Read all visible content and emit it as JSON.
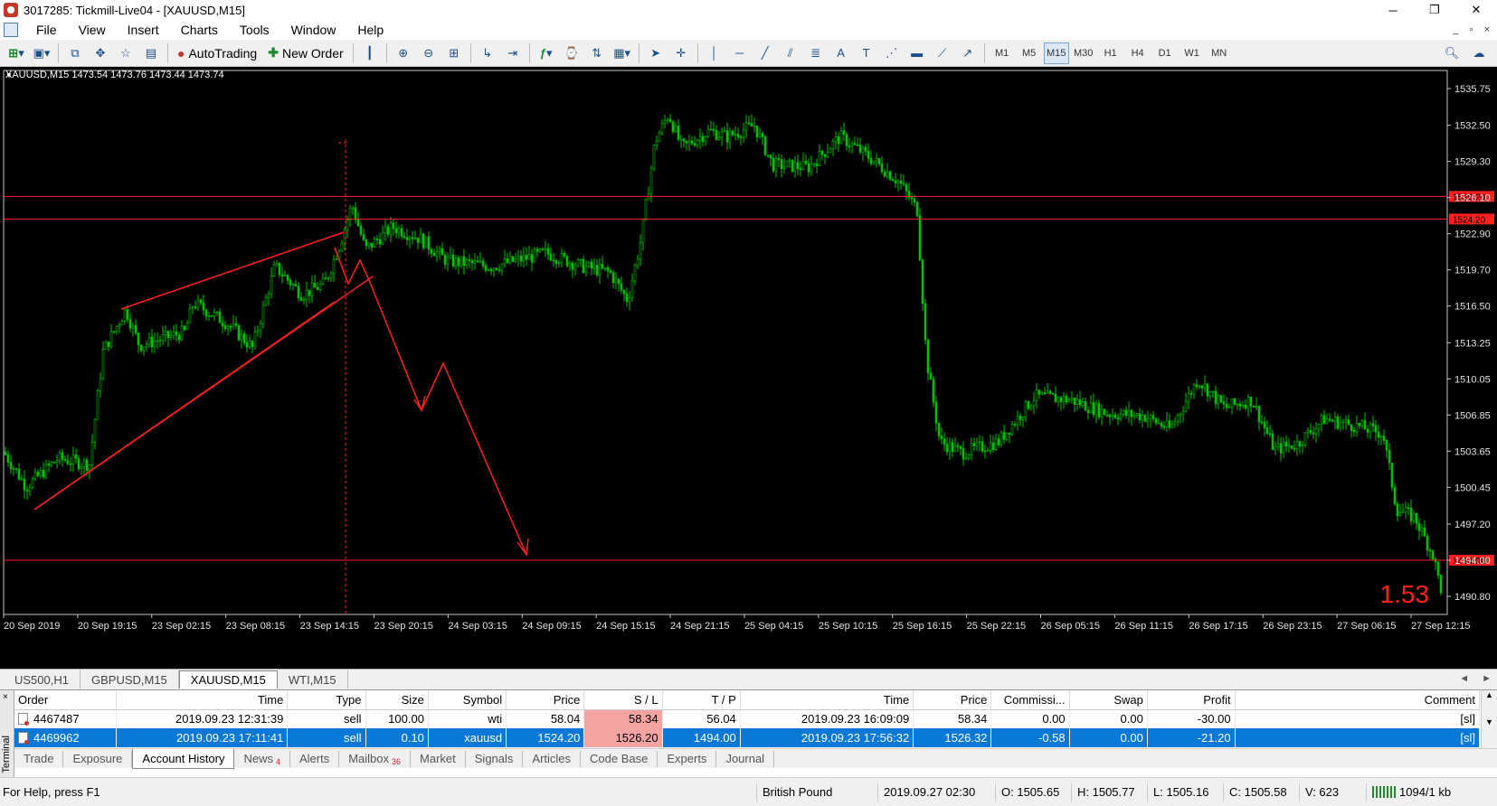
{
  "window": {
    "title": "3017285: Tickmill-Live04 - [XAUUSD,M15]",
    "controls": [
      "─",
      "❐",
      "✕"
    ]
  },
  "menu": {
    "items": [
      "File",
      "View",
      "Insert",
      "Charts",
      "Tools",
      "Window",
      "Help"
    ],
    "mdi_controls": [
      "_",
      "▫",
      "×"
    ]
  },
  "toolbar": {
    "autotrading_label": "AutoTrading",
    "new_order_label": "New Order",
    "timeframes": [
      "M1",
      "M5",
      "M15",
      "M30",
      "H1",
      "H4",
      "D1",
      "W1",
      "MN"
    ],
    "active_timeframe": "M15"
  },
  "chart": {
    "info": "XAUUSD,M15  1473.54 1473.76 1473.44 1473.74",
    "spread_label": "1.53",
    "price_ticks": [
      "1535.75",
      "1532.50",
      "1529.30",
      "1526.10",
      "1522.90",
      "1519.70",
      "1516.50",
      "1513.25",
      "1510.05",
      "1506.85",
      "1503.65",
      "1500.45",
      "1497.20",
      "1494.00",
      "1490.80"
    ],
    "time_ticks": [
      "20 Sep 2019",
      "20 Sep 19:15",
      "23 Sep 02:15",
      "23 Sep 08:15",
      "23 Sep 14:15",
      "23 Sep 20:15",
      "24 Sep 03:15",
      "24 Sep 09:15",
      "24 Sep 15:15",
      "24 Sep 21:15",
      "25 Sep 04:15",
      "25 Sep 10:15",
      "25 Sep 16:15",
      "25 Sep 22:15",
      "26 Sep 05:15",
      "26 Sep 11:15",
      "26 Sep 17:15",
      "26 Sep 23:15",
      "27 Sep 06:15",
      "27 Sep 12:15"
    ],
    "levels": [
      {
        "label": "1526.20",
        "price": 1526.2
      },
      {
        "label": "1524.20",
        "price": 1524.2
      },
      {
        "label": "1494.00",
        "price": 1494.0
      }
    ],
    "candle_color": "#00c000",
    "drawing_color": "#ff2020"
  },
  "symbol_tabs": {
    "items": [
      "US500,H1",
      "GBPUSD,M15",
      "XAUUSD,M15",
      "WTI,M15"
    ],
    "active": "XAUUSD,M15",
    "scroll": [
      "◄",
      "►"
    ]
  },
  "terminal": {
    "side_label": "Terminal",
    "close": "×",
    "columns": [
      "Order",
      "Time",
      "Type",
      "Size",
      "Symbol",
      "Price",
      "S / L",
      "T / P",
      "Time",
      "Price",
      "Commissi...",
      "Swap",
      "Profit",
      "Comment"
    ],
    "rows": [
      {
        "order": "4467487",
        "open_time": "2019.09.23 12:31:39",
        "type": "sell",
        "size": "100.00",
        "symbol": "wti",
        "price": "58.04",
        "sl": "58.34",
        "tp": "56.04",
        "close_time": "2019.09.23 16:09:09",
        "close_price": "58.34",
        "commission": "0.00",
        "swap": "0.00",
        "profit": "-30.00",
        "comment": "[sl]"
      },
      {
        "order": "4469962",
        "open_time": "2019.09.23 17:11:41",
        "type": "sell",
        "size": "0.10",
        "symbol": "xauusd",
        "price": "1524.20",
        "sl": "1526.20",
        "tp": "1494.00",
        "close_time": "2019.09.23 17:56:32",
        "close_price": "1526.32",
        "commission": "-0.58",
        "swap": "0.00",
        "profit": "-21.20",
        "comment": "[sl]"
      }
    ],
    "tabs": [
      {
        "label": "Trade",
        "badge": ""
      },
      {
        "label": "Exposure",
        "badge": ""
      },
      {
        "label": "Account History",
        "badge": ""
      },
      {
        "label": "News",
        "badge": "4"
      },
      {
        "label": "Alerts",
        "badge": ""
      },
      {
        "label": "Mailbox",
        "badge": "36"
      },
      {
        "label": "Market",
        "badge": ""
      },
      {
        "label": "Signals",
        "badge": ""
      },
      {
        "label": "Articles",
        "badge": ""
      },
      {
        "label": "Code Base",
        "badge": ""
      },
      {
        "label": "Experts",
        "badge": ""
      },
      {
        "label": "Journal",
        "badge": ""
      }
    ],
    "active_tab": "Account History"
  },
  "status": {
    "help": "For Help, press F1",
    "profile": "British Pound",
    "datetime": "2019.09.27 02:30",
    "open": "O: 1505.65",
    "high": "H: 1505.77",
    "low": "L: 1505.16",
    "close": "C: 1505.58",
    "volume": "V: 623",
    "traffic": "1094/1 kb"
  }
}
